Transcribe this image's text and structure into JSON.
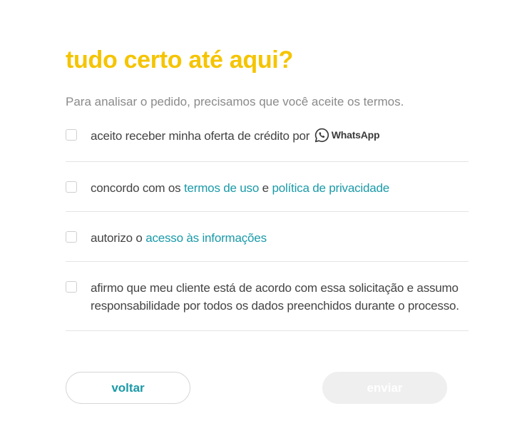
{
  "form": {
    "title": "tudo certo até aqui?",
    "subtitle": "Para analisar o pedido, precisamos que você aceite os termos.",
    "terms": [
      {
        "checked": false,
        "text": "aceito receber minha oferta de crédito por",
        "brand": "WhatsApp"
      },
      {
        "checked": false,
        "text_before": "concordo com os",
        "link1": "termos de uso",
        "joiner": "e",
        "link2": "política de privacidade"
      },
      {
        "checked": false,
        "text_before": "autorizo o",
        "link": "acesso às informações"
      },
      {
        "checked": false,
        "text": "afirmo que meu cliente está de acordo com essa solicitação e assumo responsabilidade por todos os dados preenchidos durante o processo."
      }
    ]
  },
  "buttons": {
    "back_label": "voltar",
    "send_label": "enviar",
    "send_disabled": true
  },
  "colors": {
    "title": "#f5c400",
    "link": "#1a9aa8",
    "whatsapp": "#3b3b3b",
    "disabled_button_bg": "#efefef"
  },
  "icons": {
    "whatsapp": "whatsapp-icon"
  }
}
